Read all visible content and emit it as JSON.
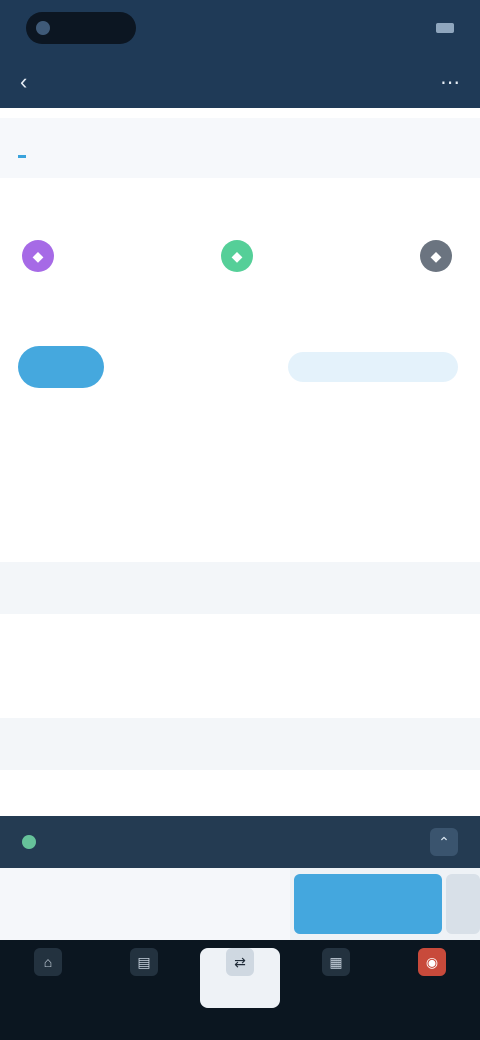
{
  "status": {
    "brand": "",
    "time": ""
  },
  "nav": {
    "back_icon": "chevron-left-icon",
    "title": "",
    "action_icon": "more-icon"
  },
  "tabs": [
    {
      "label": ""
    },
    {
      "label": ""
    },
    {
      "label": ""
    },
    {
      "label": ""
    }
  ],
  "more_link": "",
  "chips": [
    {
      "icon": "token-purple-icon",
      "glyph": "◆",
      "color": "#a66ae6",
      "label": ""
    },
    {
      "icon": "token-green-icon",
      "glyph": "◆",
      "color": "#55cf98",
      "label": ""
    },
    {
      "icon": "token-gray-icon",
      "glyph": "◆",
      "color": "#6b7480",
      "label": ""
    }
  ],
  "subnote": "",
  "segment": {
    "active": "",
    "alt": "",
    "cta": ""
  },
  "rows": [
    {
      "label": "",
      "value": ""
    },
    {
      "label": "",
      "value": ""
    },
    {
      "label": "",
      "value": ""
    },
    {
      "label": ""
    },
    {
      "label": "",
      "value": ""
    },
    {
      "label": ""
    },
    {
      "label": ""
    },
    {
      "label": "",
      "value": ""
    }
  ],
  "darkstrip": {
    "label": ""
  },
  "action": {
    "input_placeholder": "",
    "primary_label": ""
  },
  "bottom_tabs": [
    {
      "label": "",
      "icon": "home-icon"
    },
    {
      "label": "",
      "icon": "market-icon"
    },
    {
      "label": "",
      "icon": "trade-icon"
    },
    {
      "label": "",
      "icon": "portfolio-icon"
    },
    {
      "label": "",
      "icon": "bell-icon"
    }
  ],
  "colors": {
    "header": "#1f3a57",
    "accent": "#44a7de",
    "bottom": "#0b1620"
  }
}
